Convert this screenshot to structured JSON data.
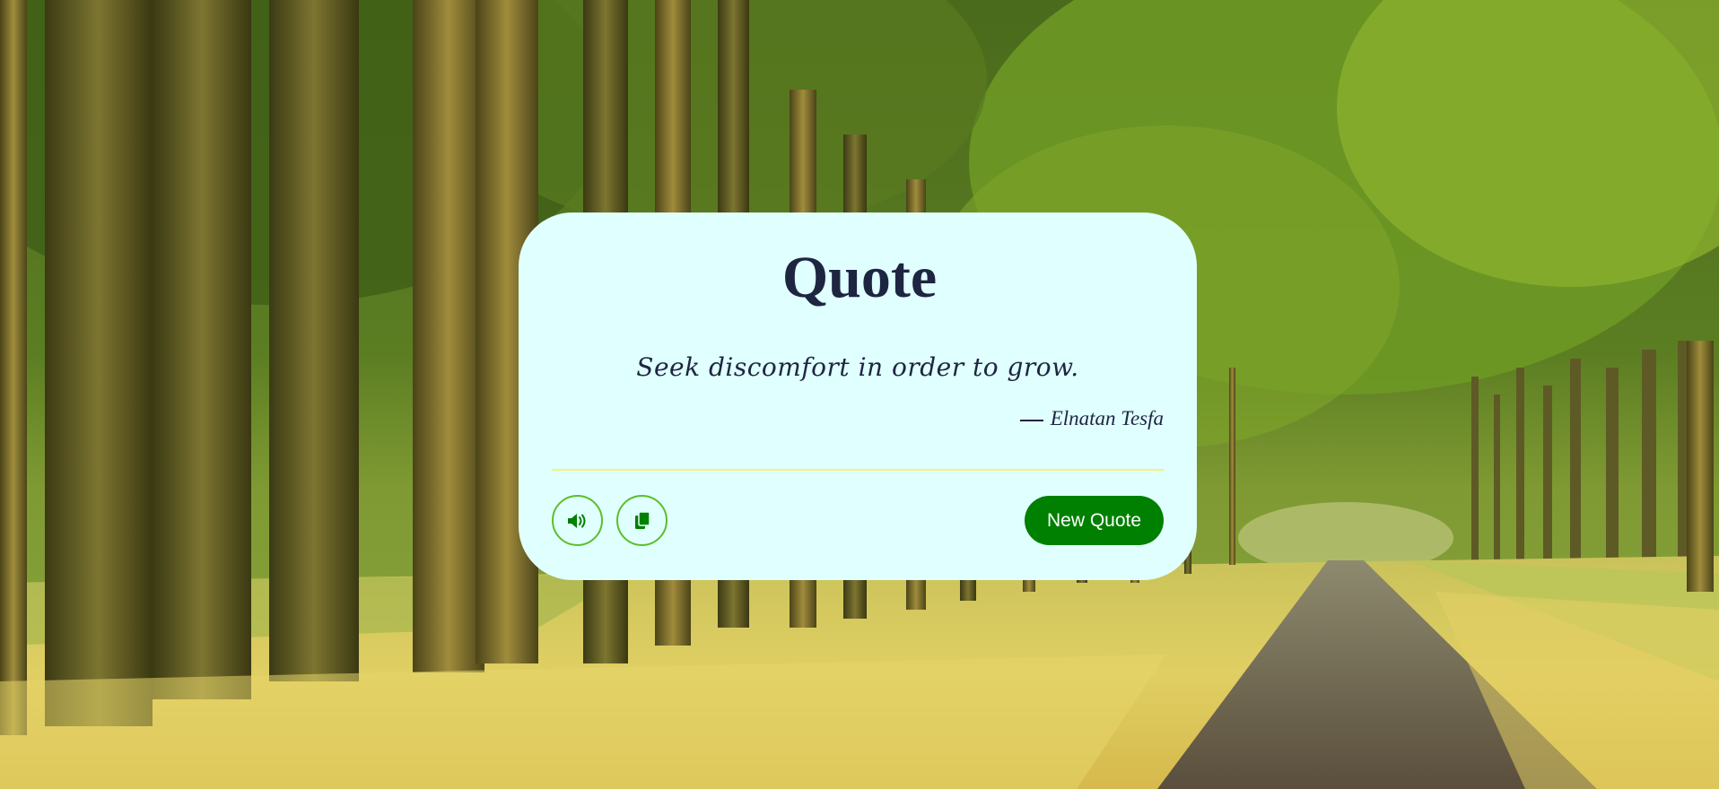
{
  "card": {
    "title": "Quote",
    "quote": "Seek discomfort in order to grow.",
    "author": "Elnatan Tesfa"
  },
  "actions": {
    "speak_icon": "speaker-icon",
    "copy_icon": "copy-icon",
    "new_quote_label": "New Quote"
  },
  "colors": {
    "card_background": "#e0ffff",
    "text": "#1e2541",
    "accent_green": "#008000",
    "icon_border": "#5cbf2a",
    "divider": "#f5f07a"
  },
  "background": {
    "scene": "tree-lined-path"
  }
}
